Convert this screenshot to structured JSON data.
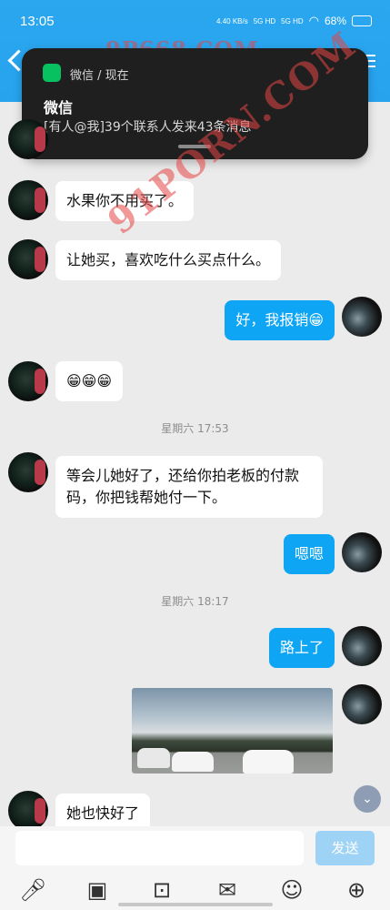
{
  "status": {
    "time": "13:05",
    "speed": "4.40 KB/s",
    "network1": "5G HD",
    "network2": "5G HD",
    "battery": "68%"
  },
  "notification": {
    "app": "微信 / 现在",
    "title": "微信",
    "body": "[有人@我]39个联系人发来43条消息"
  },
  "watermarks": [
    "9P668.COM",
    "91PORN.COM"
  ],
  "messages": [
    {
      "side": "left",
      "text": "水果你不用买了。"
    },
    {
      "side": "left",
      "text": "让她买，喜欢吃什么买点什么。"
    },
    {
      "side": "right",
      "text": "好，我报销😁"
    },
    {
      "side": "left",
      "text": "😁😁😁"
    },
    {
      "type": "time",
      "text": "星期六 17:53"
    },
    {
      "side": "left",
      "text": "等会儿她好了，还给你拍老板的付款码，你把钱帮她付一下。"
    },
    {
      "side": "right",
      "text": "嗯嗯"
    },
    {
      "type": "time",
      "text": "星期六 18:17"
    },
    {
      "side": "right",
      "text": "路上了"
    },
    {
      "side": "right",
      "type": "image"
    },
    {
      "side": "left",
      "text": "她也快好了"
    }
  ],
  "input": {
    "placeholder": "",
    "send_label": "发送"
  },
  "toolbar_icons": [
    "microphone-icon",
    "photo-icon",
    "camera-icon",
    "red-packet-icon",
    "emoji-icon",
    "plus-icon"
  ],
  "colors": {
    "header": "#27a3ee",
    "right_bubble": "#0ea5f5",
    "send_disabled": "#9fd3f6"
  }
}
